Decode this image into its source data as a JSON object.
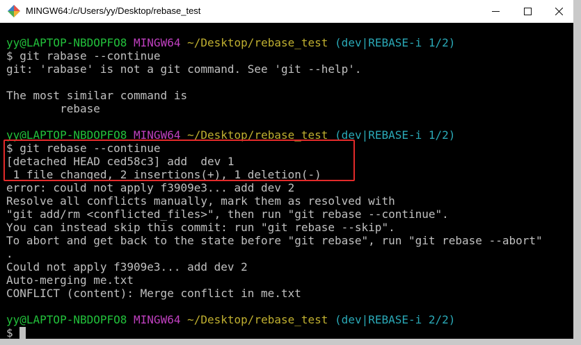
{
  "window": {
    "title": "MINGW64:/c/Users/yy/Desktop/rebase_test",
    "app_icon": "mingw-diamond-icon",
    "controls": [
      "minimize-icon",
      "maximize-icon",
      "close-icon"
    ]
  },
  "colors": {
    "background": "#000000",
    "text": "#c0c0c0",
    "prompt_user": "#22c13b",
    "prompt_system": "#c040c0",
    "prompt_path": "#c0b030",
    "prompt_branch": "#2aa9b7",
    "highlight_box": "#e32a2a"
  },
  "terminal": {
    "lines": [
      [
        {
          "t": "yy@LAPTOP-NBDOPFO8",
          "c": "green"
        },
        {
          "t": " "
        },
        {
          "t": "MINGW64",
          "c": "magenta"
        },
        {
          "t": " "
        },
        {
          "t": "~/Desktop/rebase_test",
          "c": "yellow"
        },
        {
          "t": " "
        },
        {
          "t": "(dev|REBASE-i 1/2)",
          "c": "cyan"
        }
      ],
      [
        {
          "t": "$ git rabase --continue"
        }
      ],
      [
        {
          "t": "git: 'rabase' is not a git command. See 'git --help'."
        }
      ],
      [
        {
          "t": ""
        }
      ],
      [
        {
          "t": "The most similar command is"
        }
      ],
      [
        {
          "t": "        rebase"
        }
      ],
      [
        {
          "t": ""
        }
      ],
      [
        {
          "t": "yy@LAPTOP-NBDOPFO8",
          "c": "green"
        },
        {
          "t": " "
        },
        {
          "t": "MINGW64",
          "c": "magenta"
        },
        {
          "t": " "
        },
        {
          "t": "~/Desktop/rebase_test",
          "c": "yellow"
        },
        {
          "t": " "
        },
        {
          "t": "(dev|REBASE-i 1/2)",
          "c": "cyan"
        }
      ],
      [
        {
          "t": "$ git rebase --continue"
        }
      ],
      [
        {
          "t": "[detached HEAD ced58c3] add  dev 1"
        }
      ],
      [
        {
          "t": " 1 file changed, 2 insertions(+), 1 deletion(-)"
        }
      ],
      [
        {
          "t": "error: could not apply f3909e3... add dev 2"
        }
      ],
      [
        {
          "t": "Resolve all conflicts manually, mark them as resolved with"
        }
      ],
      [
        {
          "t": "\"git add/rm <conflicted_files>\", then run \"git rebase --continue\"."
        }
      ],
      [
        {
          "t": "You can instead skip this commit: run \"git rebase --skip\"."
        }
      ],
      [
        {
          "t": "To abort and get back to the state before \"git rebase\", run \"git rebase --abort\""
        }
      ],
      [
        {
          "t": "."
        }
      ],
      [
        {
          "t": "Could not apply f3909e3... add dev 2"
        }
      ],
      [
        {
          "t": "Auto-merging me.txt"
        }
      ],
      [
        {
          "t": "CONFLICT (content): Merge conflict in me.txt"
        }
      ],
      [
        {
          "t": ""
        }
      ],
      [
        {
          "t": "yy@LAPTOP-NBDOPFO8",
          "c": "green"
        },
        {
          "t": " "
        },
        {
          "t": "MINGW64",
          "c": "magenta"
        },
        {
          "t": " "
        },
        {
          "t": "~/Desktop/rebase_test",
          "c": "yellow"
        },
        {
          "t": " "
        },
        {
          "t": "(dev|REBASE-i 2/2)",
          "c": "cyan"
        }
      ],
      [
        {
          "t": "$ "
        }
      ]
    ]
  }
}
